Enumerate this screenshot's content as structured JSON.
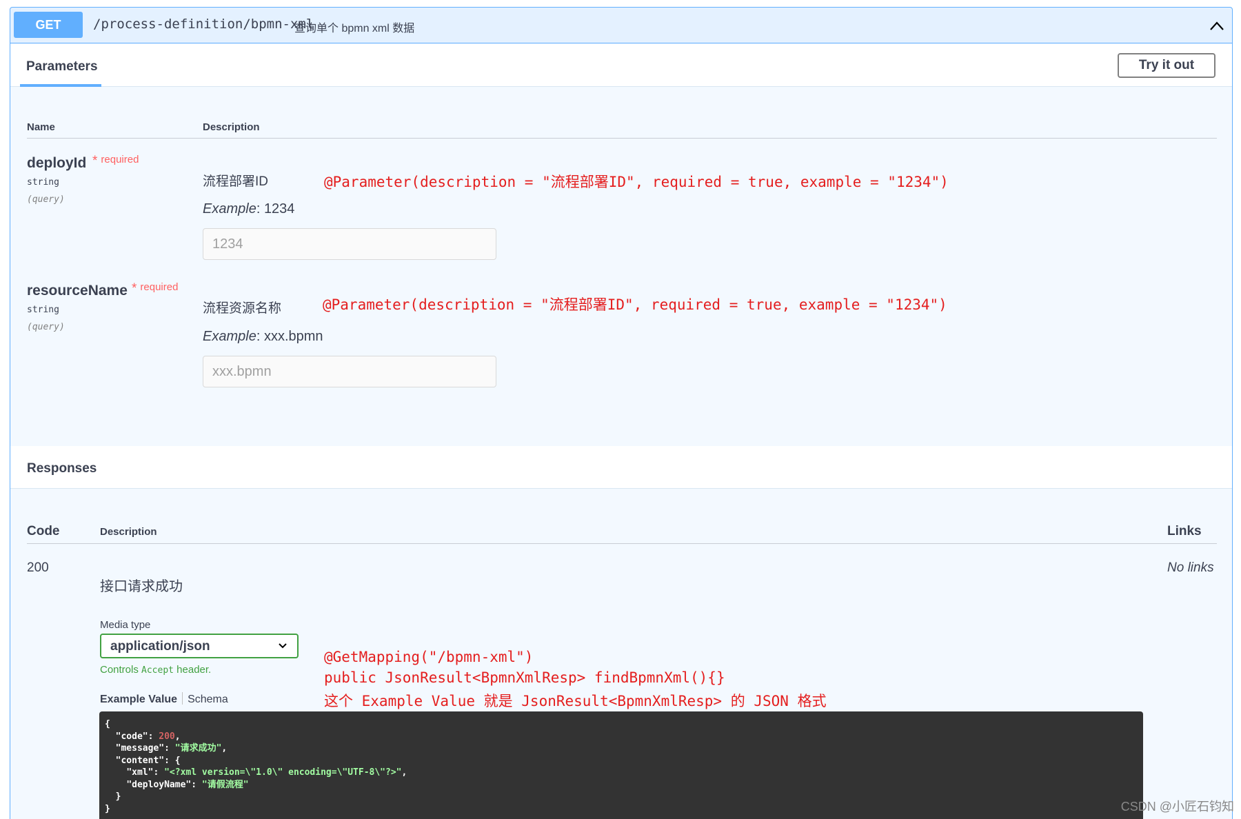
{
  "summary": {
    "method": "GET",
    "path": "/process-definition/bpmn-xml",
    "description": "查询单个 bpmn xml 数据"
  },
  "parameters": {
    "tab_label": "Parameters",
    "try_button": "Try it out",
    "col_name": "Name",
    "col_description": "Description",
    "items": [
      {
        "name": "deployId",
        "required_star": "*",
        "required_label": "required",
        "type": "string",
        "in": "(query)",
        "description": "流程部署ID",
        "example_label": "Example",
        "example_sep": ": ",
        "example_value": "1234",
        "placeholder": "1234",
        "annotation": "@Parameter(description = \"流程部署ID\", required = true, example = \"1234\")"
      },
      {
        "name": "resourceName",
        "required_star": "*",
        "required_label": "required",
        "type": "string",
        "in": "(query)",
        "description": "流程资源名称",
        "example_label": "Example",
        "example_sep": ": ",
        "example_value": "xxx.bpmn",
        "placeholder": "xxx.bpmn",
        "annotation": "@Parameter(description = \"流程部署ID\", required = true, example = \"1234\")"
      }
    ]
  },
  "responses": {
    "title": "Responses",
    "col_code": "Code",
    "col_description": "Description",
    "col_links": "Links",
    "rows": [
      {
        "code": "200",
        "description": "接口请求成功",
        "links": "No links",
        "media_type_label": "Media type",
        "media_type": "application/json",
        "controls_prefix": "Controls ",
        "controls_code": "Accept",
        "controls_suffix": " header.",
        "example_tab": "Example Value",
        "schema_tab": "Schema"
      }
    ],
    "annotation_lines": [
      "@GetMapping(\"/bpmn-xml\")",
      "public JsonResult<BpmnXmlResp> findBpmnXml(){}",
      "这个 Example Value 就是 JsonResult<BpmnXmlResp> 的 JSON 格式"
    ]
  },
  "example_json": {
    "open": "{",
    "code_key": "\"code\"",
    "code_val": "200",
    "message_key": "\"message\"",
    "message_val": "\"请求成功\"",
    "content_key": "\"content\"",
    "content_open": "{",
    "xml_key": "\"xml\"",
    "xml_val": "\"<?xml version=\\\"1.0\\\" encoding=\\\"UTF-8\\\"?>\"",
    "deployName_key": "\"deployName\"",
    "deployName_val": "\"请假流程\"",
    "content_close": "}",
    "close": "}"
  },
  "watermark": "CSDN @小匠石钧知",
  "colors": {
    "get_blue": "#61affe",
    "annotation_red": "#e41e1e",
    "required_red": "#ff6060",
    "select_green": "#41a141",
    "code_bg": "#333333"
  },
  "icons": [
    "chevron-up-icon",
    "chevron-down-icon"
  ]
}
